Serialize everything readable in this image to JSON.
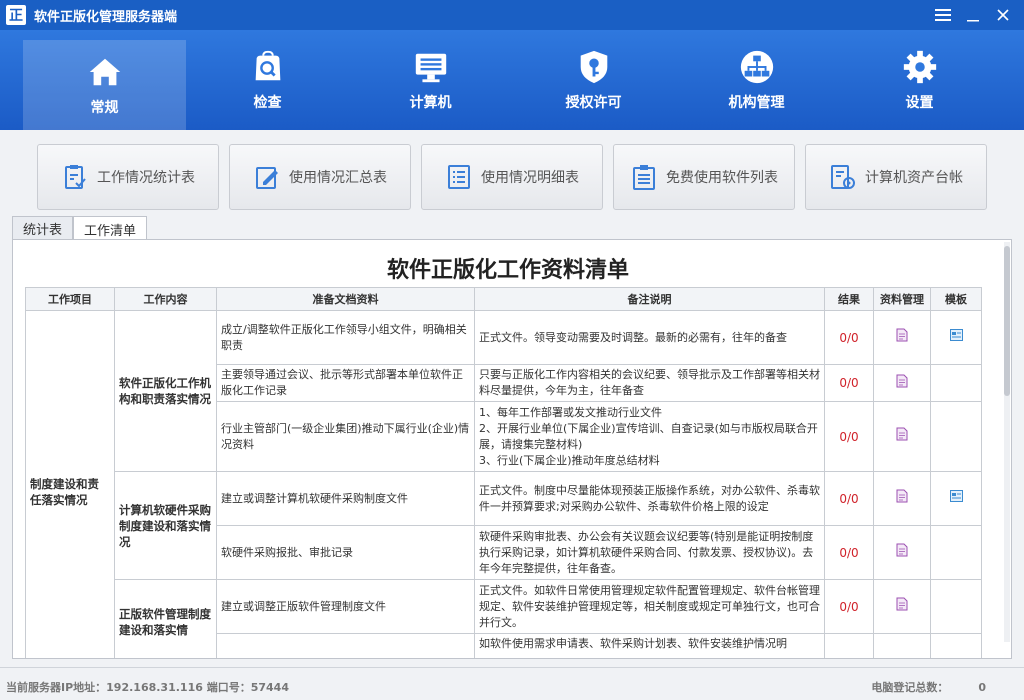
{
  "app": {
    "logo": "正",
    "title": "软件正版化管理服务器端"
  },
  "nav": [
    {
      "label": "常规",
      "icon": "home-icon"
    },
    {
      "label": "检查",
      "icon": "search-bag-icon"
    },
    {
      "label": "计算机",
      "icon": "computer-icon"
    },
    {
      "label": "授权许可",
      "icon": "key-shield-icon"
    },
    {
      "label": "机构管理",
      "icon": "org-chart-icon"
    },
    {
      "label": "设置",
      "icon": "gear-icon"
    }
  ],
  "subnav": [
    {
      "label": "工作情况统计表"
    },
    {
      "label": "使用情况汇总表"
    },
    {
      "label": "使用情况明细表"
    },
    {
      "label": "免费使用软件列表"
    },
    {
      "label": "计算机资产台帐"
    }
  ],
  "tabs": [
    {
      "label": "统计表"
    },
    {
      "label": "工作清单"
    }
  ],
  "doc": {
    "title": "软件正版化工作资料清单",
    "headers": [
      "工作项目",
      "工作内容",
      "准备文档资料",
      "备注说明",
      "结果",
      "资料管理",
      "模板"
    ],
    "project": "制度建设和责任落实情况",
    "contents": [
      "软件正版化工作机构和职责落实情况",
      "计算机软硬件采购制度建设和落实情况",
      "正版软件管理制度建设和落实情"
    ],
    "rows": [
      {
        "doc": "成立/调整软件正版化工作领导小组文件，明确相关职责",
        "note": "正式文件。领导变动需要及时调整。最新的必需有，往年的备查",
        "result": "0/0",
        "template": true
      },
      {
        "doc": "主要领导通过会议、批示等形式部署本单位软件正版化工作记录",
        "note": "只要与正版化工作内容相关的会议纪要、领导批示及工作部署等相关材料尽量提供，今年为主，往年备查",
        "result": "0/0",
        "template": false
      },
      {
        "doc": "行业主管部门(一级企业集团)推动下属行业(企业)情况资料",
        "note": "1、每年工作部署或发文推动行业文件\n2、开展行业单位(下属企业)宣传培训、自查记录(如与市版权局联合开展，请搜集完整材料)\n3、行业(下属企业)推动年度总结材料",
        "result": "0/0",
        "template": false
      },
      {
        "doc": "建立或调整计算机软硬件采购制度文件",
        "note": "正式文件。制度中尽量能体现预装正版操作系统，对办公软件、杀毒软件一并预算要求;对采购办公软件、杀毒软件价格上限的设定",
        "result": "0/0",
        "template": true
      },
      {
        "doc": "软硬件采购报批、审批记录",
        "note": "软硬件采购审批表、办公会有关议题会议纪要等(特别是能证明按制度执行采购记录，如计算机软硬件采购合同、付款发票、授权协议)。去年今年完整提供，往年备查。",
        "result": "0/0",
        "template": false
      },
      {
        "doc": "建立或调整正版软件管理制度文件",
        "note": "正式文件。如软件日常使用管理规定软件配置管理规定、软件台帐管理规定、软件安装维护管理规定等，相关制度或规定可单独行文，也可合并行文。",
        "result": "0/0",
        "template": false
      },
      {
        "doc": "",
        "note": "如软件使用需求申请表、软件采购计划表、软件安装维护情况明",
        "result": "",
        "template": false
      }
    ]
  },
  "status": {
    "server": "当前服务器IP地址：192.168.31.116  端口号：57444",
    "count_label": "电脑登记总数：",
    "count": "0"
  },
  "colors": {
    "titlebar": "#1a5fc4",
    "nav": "#2f78de",
    "result": "#d0222a"
  }
}
